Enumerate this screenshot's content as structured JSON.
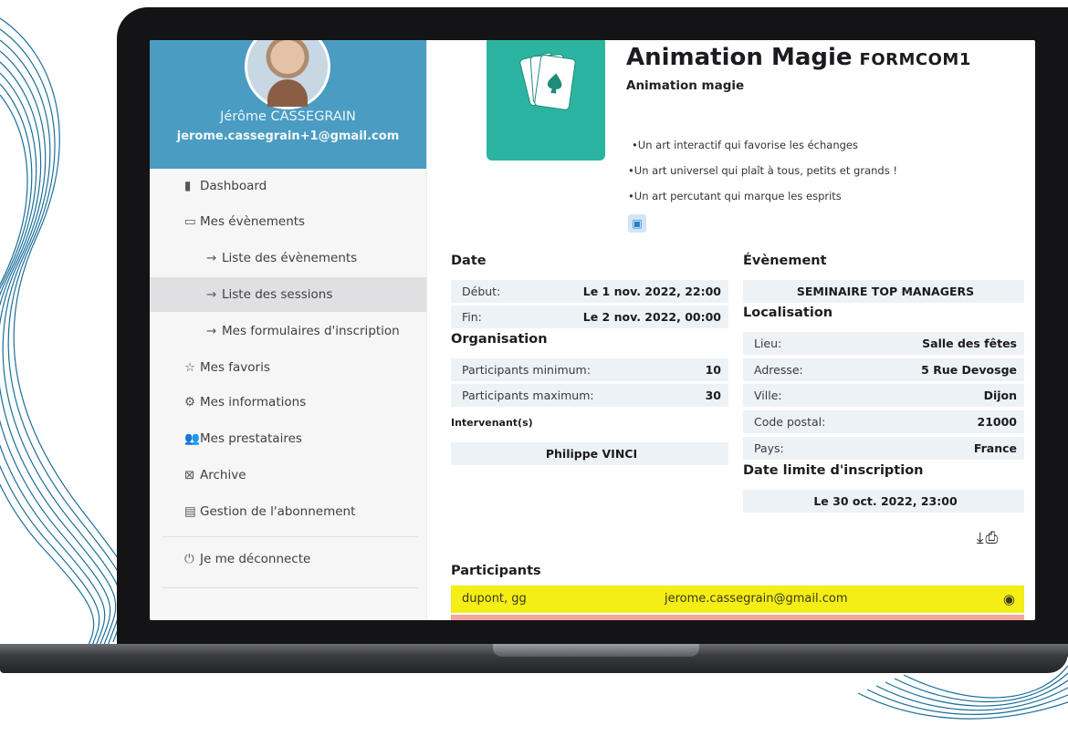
{
  "profile": {
    "name": "Jérôme CASSEGRAIN",
    "email": "jerome.cassegrain+1@gmail.com"
  },
  "sidebar": {
    "items": [
      {
        "icon": "bar-chart-icon",
        "glyph": "▮",
        "label": "Dashboard",
        "indent": false,
        "active": false
      },
      {
        "icon": "calendar-icon",
        "glyph": "▭",
        "label": "Mes évènements",
        "indent": false,
        "active": false
      },
      {
        "icon": "arrow-right-icon",
        "glyph": "→",
        "label": "Liste des évènements",
        "indent": true,
        "active": false
      },
      {
        "icon": "arrow-right-icon",
        "glyph": "→",
        "label": "Liste des sessions",
        "indent": true,
        "active": true
      },
      {
        "icon": "arrow-right-icon",
        "glyph": "→",
        "label": "Mes formulaires d'inscription",
        "indent": true,
        "active": false
      },
      {
        "icon": "star-icon",
        "glyph": "☆",
        "label": "Mes favoris",
        "indent": false,
        "active": false
      },
      {
        "icon": "settings-icon",
        "glyph": "⚙",
        "label": "Mes informations",
        "indent": false,
        "active": false
      },
      {
        "icon": "users-icon",
        "glyph": "👥",
        "label": "Mes prestataires",
        "indent": false,
        "active": false
      },
      {
        "icon": "archive-icon",
        "glyph": "⊠",
        "label": "Archive",
        "indent": false,
        "active": false
      },
      {
        "icon": "subscription-icon",
        "glyph": "▤",
        "label": "Gestion de l'abonnement",
        "indent": false,
        "active": false
      }
    ],
    "logout": {
      "icon": "power-icon",
      "glyph": "⏻",
      "label": "Je me déconnecte"
    }
  },
  "event": {
    "title": "Animation Magie",
    "code": "FORMCOM1",
    "subtitle": "Animation magie",
    "bullets": [
      "•Un art interactif qui favorise les échanges",
      "•Un art universel qui plaît à tous, petits et grands !",
      "•Un art percutant qui marque les esprits"
    ]
  },
  "date": {
    "title": "Date",
    "rows": [
      {
        "label": "Début:",
        "value": "Le 1 nov. 2022, 22:00"
      },
      {
        "label": "Fin:",
        "value": "Le 2 nov. 2022, 00:00"
      }
    ]
  },
  "organisation": {
    "title": "Organisation",
    "rows": [
      {
        "label": "Participants minimum:",
        "value": "10"
      },
      {
        "label": "Participants maximum:",
        "value": "30"
      }
    ],
    "intervenant_title": "Intervenant(s)",
    "intervenant": "Philippe VINCI"
  },
  "evenement": {
    "title": "Évènement",
    "name": "SEMINAIRE TOP MANAGERS"
  },
  "localisation": {
    "title": "Localisation",
    "rows": [
      {
        "label": "Lieu:",
        "value": "Salle des fêtes"
      },
      {
        "label": "Adresse:",
        "value": "5 Rue Devosge"
      },
      {
        "label": "Ville:",
        "value": "Dijon"
      },
      {
        "label": "Code postal:",
        "value": "21000"
      },
      {
        "label": "Pays:",
        "value": "France"
      }
    ]
  },
  "deadline": {
    "title": "Date limite d'inscription",
    "value": "Le 30 oct. 2022, 23:00"
  },
  "participants": {
    "title": "Participants",
    "rows": [
      {
        "name": "dupont, gg",
        "email": "jerome.cassegrain@gmail.com"
      }
    ]
  },
  "colors": {
    "profile_bg": "#4a9cc2",
    "event_image_bg": "#2bb5a0",
    "participant_highlight": "#f4ed16",
    "info_row_bg": "#edf2f7"
  }
}
